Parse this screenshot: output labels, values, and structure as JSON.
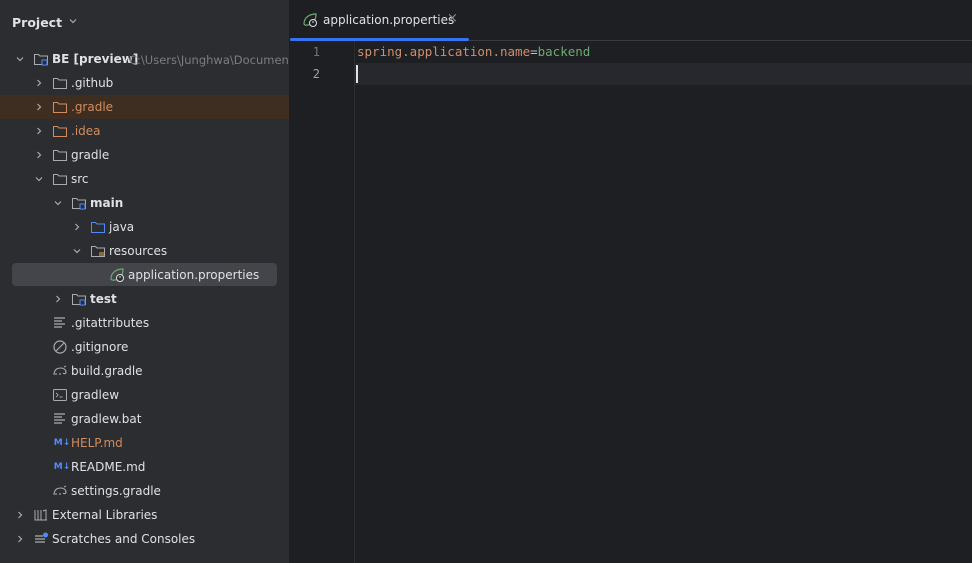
{
  "sidebar": {
    "title": "Project",
    "root": {
      "name": "BE",
      "badge": "[preview]",
      "path": "C:\\Users\\Junghwa\\Documents"
    },
    "items": {
      "github": ".github",
      "gradle_dot": ".gradle",
      "idea": ".idea",
      "gradle": "gradle",
      "src": "src",
      "main": "main",
      "java": "java",
      "resources": "resources",
      "app_props": "application.properties",
      "test": "test",
      "gitattributes": ".gitattributes",
      "gitignore": ".gitignore",
      "build_gradle": "build.gradle",
      "gradlew": "gradlew",
      "gradlew_bat": "gradlew.bat",
      "help_md": "HELP.md",
      "readme_md": "README.md",
      "settings_gradle": "settings.gradle",
      "external_libraries": "External Libraries",
      "scratches": "Scratches and Consoles"
    }
  },
  "editor": {
    "tab_label": "application.properties",
    "close_glyph": "×",
    "line_numbers": [
      "1",
      "2"
    ],
    "code": {
      "key": "spring.application.name",
      "eq": "=",
      "value": "backend"
    }
  },
  "colors": {
    "accent": "#3574f0",
    "orange": "#d18d5e",
    "spring_green": "#6aab73",
    "key_orange": "#cf8e6d"
  }
}
